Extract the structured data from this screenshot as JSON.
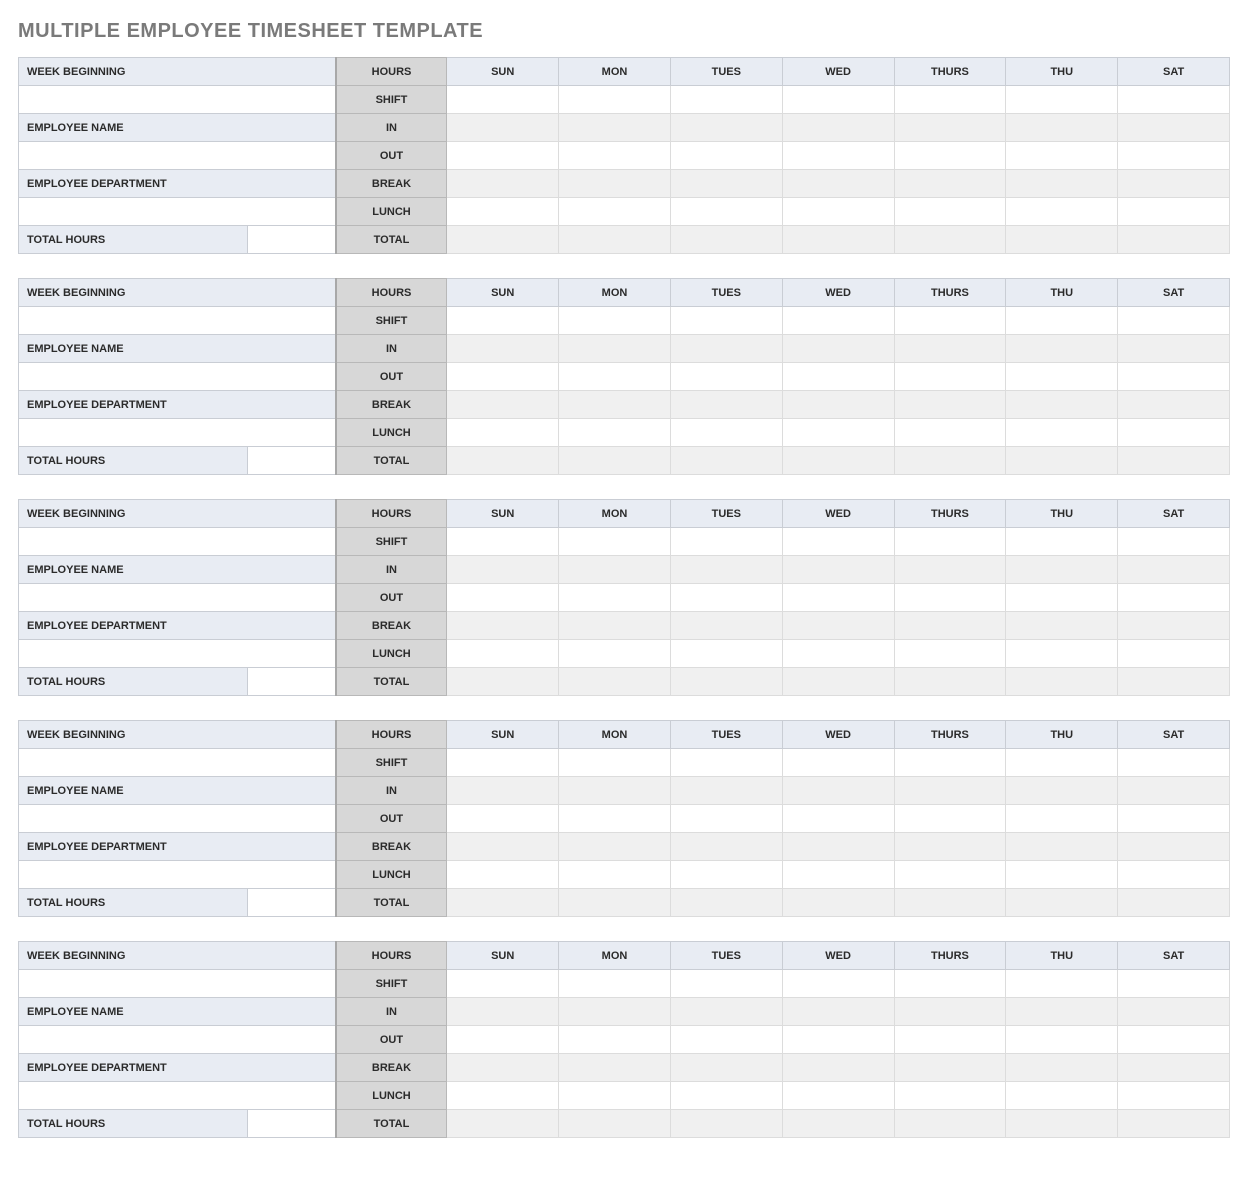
{
  "title": "MULTIPLE EMPLOYEE TIMESHEET TEMPLATE",
  "labels": {
    "week_beginning": "WEEK BEGINNING",
    "employee_name": "EMPLOYEE NAME",
    "employee_department": "EMPLOYEE DEPARTMENT",
    "total_hours": "TOTAL HOURS",
    "hours": "HOURS",
    "row_labels": [
      "SHIFT",
      "IN",
      "OUT",
      "BREAK",
      "LUNCH",
      "TOTAL"
    ]
  },
  "days": [
    "SUN",
    "MON",
    "TUES",
    "WED",
    "THURS",
    "THU",
    "SAT"
  ],
  "employees": [
    {
      "week_beginning": "",
      "employee_name": "",
      "employee_department": "",
      "total_hours": "",
      "data": {
        "SHIFT": [
          "",
          "",
          "",
          "",
          "",
          "",
          ""
        ],
        "IN": [
          "",
          "",
          "",
          "",
          "",
          "",
          ""
        ],
        "OUT": [
          "",
          "",
          "",
          "",
          "",
          "",
          ""
        ],
        "BREAK": [
          "",
          "",
          "",
          "",
          "",
          "",
          ""
        ],
        "LUNCH": [
          "",
          "",
          "",
          "",
          "",
          "",
          ""
        ],
        "TOTAL": [
          "",
          "",
          "",
          "",
          "",
          "",
          ""
        ]
      }
    },
    {
      "week_beginning": "",
      "employee_name": "",
      "employee_department": "",
      "total_hours": "",
      "data": {
        "SHIFT": [
          "",
          "",
          "",
          "",
          "",
          "",
          ""
        ],
        "IN": [
          "",
          "",
          "",
          "",
          "",
          "",
          ""
        ],
        "OUT": [
          "",
          "",
          "",
          "",
          "",
          "",
          ""
        ],
        "BREAK": [
          "",
          "",
          "",
          "",
          "",
          "",
          ""
        ],
        "LUNCH": [
          "",
          "",
          "",
          "",
          "",
          "",
          ""
        ],
        "TOTAL": [
          "",
          "",
          "",
          "",
          "",
          "",
          ""
        ]
      }
    },
    {
      "week_beginning": "",
      "employee_name": "",
      "employee_department": "",
      "total_hours": "",
      "data": {
        "SHIFT": [
          "",
          "",
          "",
          "",
          "",
          "",
          ""
        ],
        "IN": [
          "",
          "",
          "",
          "",
          "",
          "",
          ""
        ],
        "OUT": [
          "",
          "",
          "",
          "",
          "",
          "",
          ""
        ],
        "BREAK": [
          "",
          "",
          "",
          "",
          "",
          "",
          ""
        ],
        "LUNCH": [
          "",
          "",
          "",
          "",
          "",
          "",
          ""
        ],
        "TOTAL": [
          "",
          "",
          "",
          "",
          "",
          "",
          ""
        ]
      }
    },
    {
      "week_beginning": "",
      "employee_name": "",
      "employee_department": "",
      "total_hours": "",
      "data": {
        "SHIFT": [
          "",
          "",
          "",
          "",
          "",
          "",
          ""
        ],
        "IN": [
          "",
          "",
          "",
          "",
          "",
          "",
          ""
        ],
        "OUT": [
          "",
          "",
          "",
          "",
          "",
          "",
          ""
        ],
        "BREAK": [
          "",
          "",
          "",
          "",
          "",
          "",
          ""
        ],
        "LUNCH": [
          "",
          "",
          "",
          "",
          "",
          "",
          ""
        ],
        "TOTAL": [
          "",
          "",
          "",
          "",
          "",
          "",
          ""
        ]
      }
    },
    {
      "week_beginning": "",
      "employee_name": "",
      "employee_department": "",
      "total_hours": "",
      "data": {
        "SHIFT": [
          "",
          "",
          "",
          "",
          "",
          "",
          ""
        ],
        "IN": [
          "",
          "",
          "",
          "",
          "",
          "",
          ""
        ],
        "OUT": [
          "",
          "",
          "",
          "",
          "",
          "",
          ""
        ],
        "BREAK": [
          "",
          "",
          "",
          "",
          "",
          "",
          ""
        ],
        "LUNCH": [
          "",
          "",
          "",
          "",
          "",
          "",
          ""
        ],
        "TOTAL": [
          "",
          "",
          "",
          "",
          "",
          "",
          ""
        ]
      }
    }
  ]
}
